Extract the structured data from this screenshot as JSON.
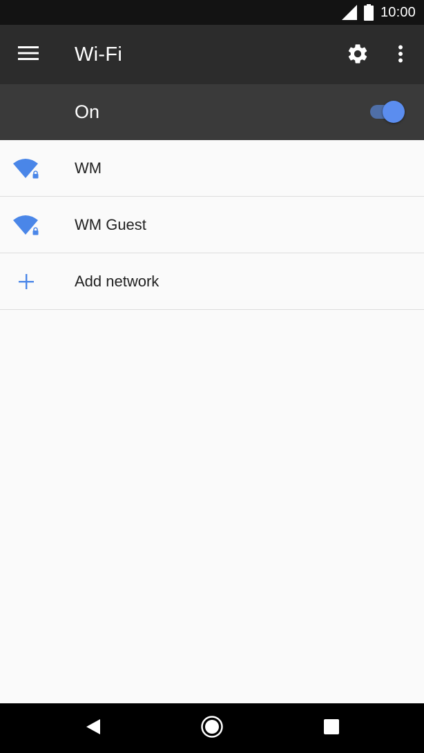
{
  "status_bar": {
    "time": "10:00",
    "icons": [
      "signal-icon",
      "battery-icon"
    ]
  },
  "app_bar": {
    "title": "Wi-Fi",
    "menu_icon": "menu-icon",
    "settings_icon": "gear-icon",
    "overflow_icon": "more-vert-icon"
  },
  "wifi_switch": {
    "label": "On",
    "state": "on",
    "accent_color": "#5b8def"
  },
  "networks": [
    {
      "name": "WM",
      "icon": "wifi-locked-icon"
    },
    {
      "name": "WM Guest",
      "icon": "wifi-locked-icon"
    }
  ],
  "add_network": {
    "label": "Add network",
    "icon": "plus-icon"
  },
  "nav_bar": {
    "buttons": [
      "back-icon",
      "home-icon",
      "recents-icon"
    ]
  },
  "colors": {
    "accent": "#4a86e8",
    "status_bar": "#131313",
    "app_bar": "#2c2c2c",
    "switch_bar": "#3a3a3a",
    "background": "#fafafa"
  }
}
